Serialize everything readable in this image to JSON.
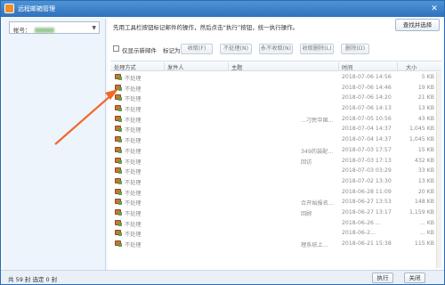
{
  "window": {
    "title": "远程邮箱管理"
  },
  "sidebar": {
    "account_label": "帐号："
  },
  "main": {
    "hint": "先用工具栏按钮标记邮件的操作，然后点击“执行”按钮，统一执行操作。",
    "find_button": "查找并选择"
  },
  "filter": {
    "checkbox_label": "仅显示新邮件",
    "mark_label": "标记为:",
    "buttons": [
      "收取(F)",
      "不处理(N)",
      "永不收取(N)",
      "收取删除(L)",
      "删除(D)"
    ]
  },
  "table": {
    "headers": [
      "处理方式",
      "发件人",
      "主题",
      "时间",
      "大小"
    ],
    "rows": [
      {
        "action": "不处理",
        "subject": "",
        "time": "2018-07-06 14:56",
        "size": "5 KB"
      },
      {
        "action": "不处理",
        "subject": "",
        "time": "2018-07-06 14:46",
        "size": "19 KB"
      },
      {
        "action": "不处理",
        "subject": "",
        "time": "2018-07-06 14:20",
        "size": "21 KB"
      },
      {
        "action": "不处理",
        "subject": "",
        "time": "2018-07-06 14:13",
        "size": "13 KB"
      },
      {
        "action": "不处理",
        "subject": "...刁民中国...",
        "time": "2018-07-05 10:56",
        "size": "43 KB"
      },
      {
        "action": "不处理",
        "subject": "",
        "time": "2018-07-04 14:37",
        "size": "1,045 KB"
      },
      {
        "action": "不处理",
        "subject": "",
        "time": "2018-07-04 14:37",
        "size": "1,045 KB"
      },
      {
        "action": "不处理",
        "subject": "349的装配...",
        "time": "2018-07-03 17:57",
        "size": "15 KB"
      },
      {
        "action": "不处理",
        "subject": "回访",
        "time": "2018-07-03 17:13",
        "size": "432 KB"
      },
      {
        "action": "不处理",
        "subject": "",
        "time": "2018-07-03 03:29",
        "size": "33 KB"
      },
      {
        "action": "不处理",
        "subject": "",
        "time": "2018-07-02 13:30",
        "size": "13 KB"
      },
      {
        "action": "不处理",
        "subject": "",
        "time": "2018-06-28 11:09",
        "size": "20 KB"
      },
      {
        "action": "不处理",
        "subject": "合开始报名...",
        "time": "2018-06-27 13:53",
        "size": "148 KB"
      },
      {
        "action": "不处理",
        "subject": "回顾",
        "time": "2018-06-27 13:17",
        "size": "1,159 KB"
      },
      {
        "action": "不处理",
        "subject": "",
        "time": "2018-06-26 ...",
        "size": "... KB"
      },
      {
        "action": "不处理",
        "subject": "",
        "time": "2018-06-2...",
        "size": "... KB"
      },
      {
        "action": "不处理",
        "subject": "理系统上...",
        "time": "2018-06-21 15:38",
        "size": "115 KB"
      }
    ]
  },
  "status": {
    "text": "共 59 封  选定 0 封",
    "execute_button": "执行",
    "close_button": "关闭"
  },
  "colors": {
    "titlebar": "#3a7fc8",
    "arrow": "#f06a2a",
    "icon": "#c8753a"
  }
}
